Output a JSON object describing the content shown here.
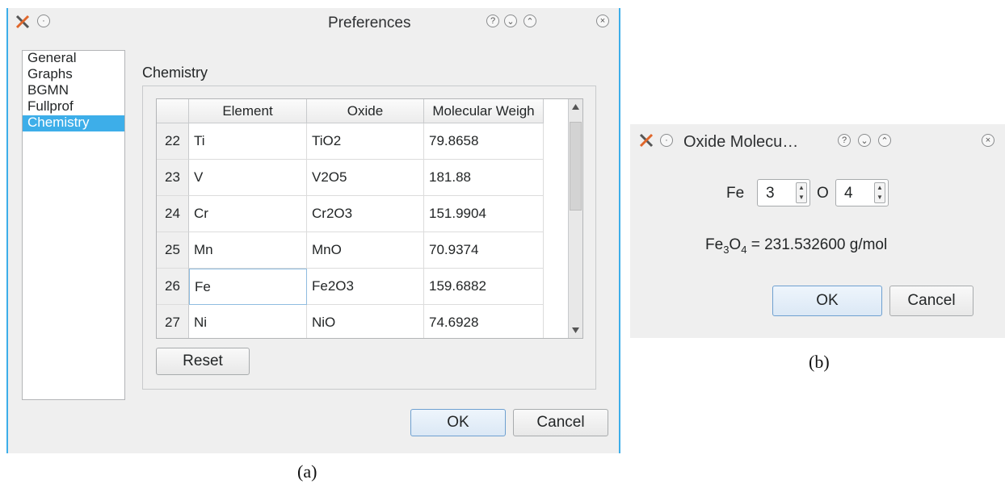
{
  "prefs": {
    "title": "Preferences",
    "titlebar_buttons": [
      "?",
      "⌄",
      "⌃",
      "×"
    ],
    "sidebar": {
      "items": [
        {
          "label": "General"
        },
        {
          "label": "Graphs"
        },
        {
          "label": "BGMN"
        },
        {
          "label": "Fullprof"
        },
        {
          "label": "Chemistry"
        }
      ],
      "selected": "Chemistry"
    },
    "group_title": "Chemistry",
    "table": {
      "headers": [
        "Element",
        "Oxide",
        "Molecular Weigh"
      ],
      "rows": [
        {
          "num": "22",
          "element": "Ti",
          "oxide": "TiO2",
          "weight": "79.8658"
        },
        {
          "num": "23",
          "element": "V",
          "oxide": "V2O5",
          "weight": "181.88"
        },
        {
          "num": "24",
          "element": "Cr",
          "oxide": "Cr2O3",
          "weight": "151.9904"
        },
        {
          "num": "25",
          "element": "Mn",
          "oxide": "MnO",
          "weight": "70.9374"
        },
        {
          "num": "26",
          "element": "Fe",
          "oxide": "Fe2O3",
          "weight": "159.6882"
        },
        {
          "num": "27",
          "element": "Ni",
          "oxide": "NiO",
          "weight": "74.6928"
        }
      ]
    },
    "reset_label": "Reset",
    "ok_label": "OK",
    "cancel_label": "Cancel",
    "caption": "(a)"
  },
  "oxide_dialog": {
    "title": "Oxide Molecu…",
    "element1": "Fe",
    "count1": "3",
    "element2": "O",
    "count2": "4",
    "formula_base1": "Fe",
    "formula_sub1": "3",
    "formula_base2": "O",
    "formula_sub2": "4",
    "formula_rest": " = 231.532600 g/mol",
    "ok_label": "OK",
    "cancel_label": "Cancel",
    "caption": "(b)"
  }
}
